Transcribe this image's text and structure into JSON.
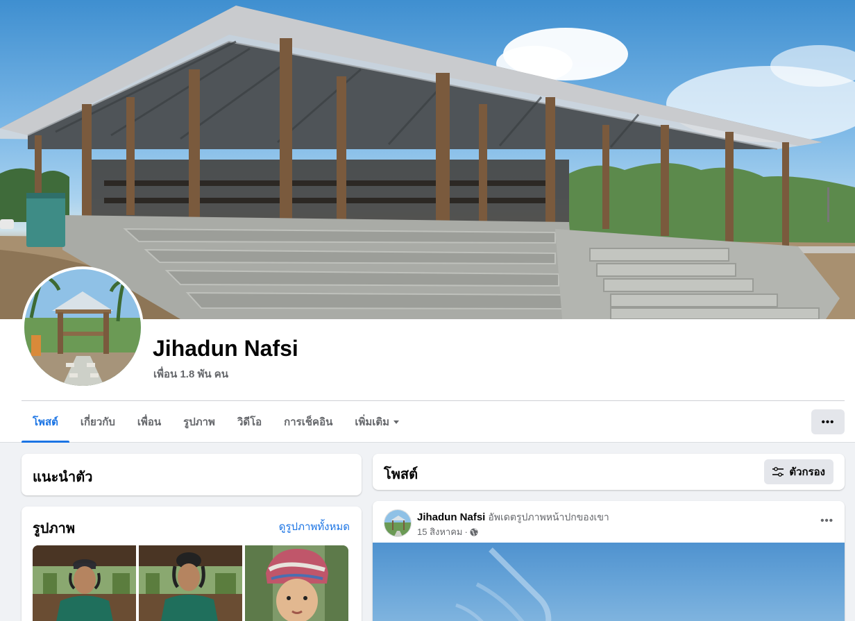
{
  "profile": {
    "name": "Jihadun Nafsi",
    "friends": "เพื่อน 1.8 พัน คน"
  },
  "tabs": [
    {
      "label": "โพสต์",
      "active": true
    },
    {
      "label": "เกี่ยวกับ"
    },
    {
      "label": "เพื่อน"
    },
    {
      "label": "รูปภาพ"
    },
    {
      "label": "วิดีโอ"
    },
    {
      "label": "การเช็คอิน"
    },
    {
      "label": "เพิ่มเติม"
    }
  ],
  "more_button": "•••",
  "intro": {
    "title": "แนะนำตัว"
  },
  "photos": {
    "title": "รูปภาพ",
    "see_all": "ดูรูปภาพทั้งหมด"
  },
  "posts": {
    "title": "โพสต์",
    "filter_label": "ตัวกรอง"
  },
  "post": {
    "author": "Jihadun Nafsi",
    "action": "อัพเดตรูปภาพหน้าปกของเขา",
    "date": "15 สิงหาคม",
    "separator": "·",
    "menu": "•••"
  },
  "colors": {
    "accent": "#1b74e4",
    "background": "#f0f2f5",
    "secondary_text": "#65676b"
  }
}
